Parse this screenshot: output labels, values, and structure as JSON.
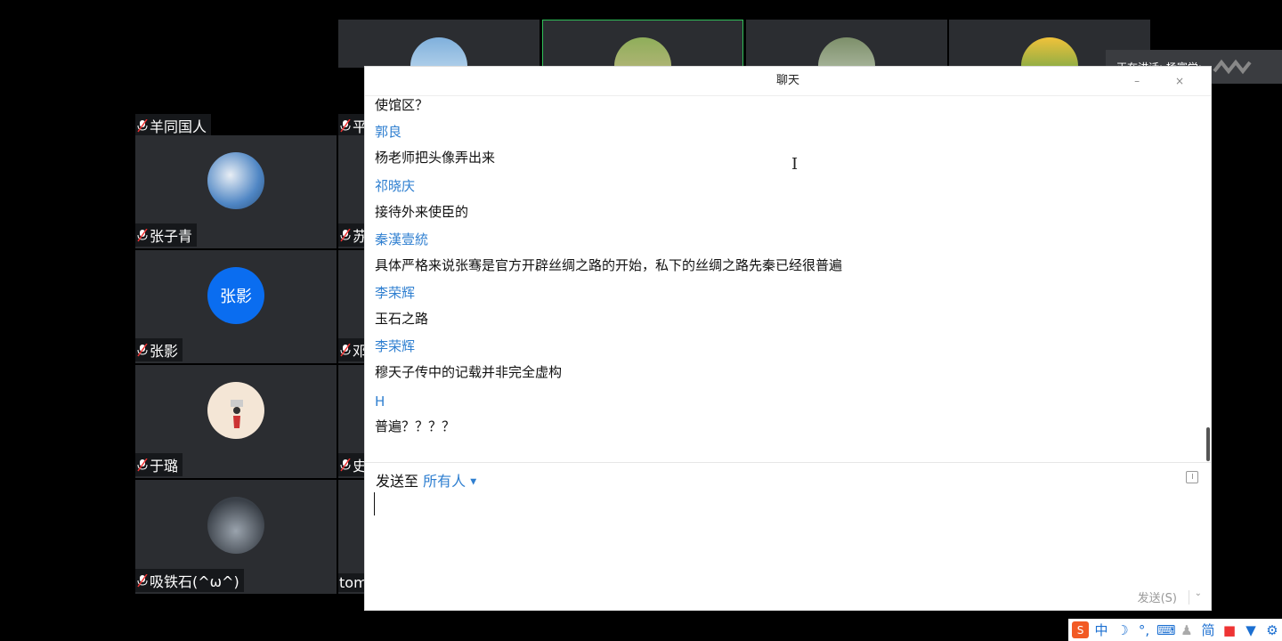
{
  "grid": {
    "tiles_left": [
      {
        "name": "羊同国人",
        "avatar_text": ""
      },
      {
        "name": "张子青",
        "avatar_text": ""
      },
      {
        "name": "张影",
        "avatar_text": "张影"
      },
      {
        "name": "于璐",
        "avatar_text": ""
      },
      {
        "name": "吸铁石(^ω^)",
        "avatar_text": ""
      }
    ],
    "tiles_col2": [
      {
        "name": "平"
      },
      {
        "name": "苏"
      },
      {
        "name": "邓"
      },
      {
        "name": "史"
      },
      {
        "name": "tom"
      }
    ]
  },
  "speaking": {
    "label": "正在讲话: 杨富学;"
  },
  "chat": {
    "title": "聊天",
    "messages": [
      {
        "text": "使馆区？"
      },
      {
        "sender": "郭良",
        "text": "杨老师把头像弄出来"
      },
      {
        "sender": "祁晓庆",
        "text": "接待外来使臣的"
      },
      {
        "sender": "秦漢壹統",
        "text": "具体严格来说张骞是官方开辟丝绸之路的开始，私下的丝绸之路先秦已经很普遍"
      },
      {
        "sender": "李荣辉",
        "text": "玉石之路"
      },
      {
        "sender": "李荣辉",
        "text": "穆天子传中的记载并非完全虚构"
      },
      {
        "sender": "H",
        "text": "普遍？？？？"
      }
    ],
    "send_to_label": "发送至",
    "send_to_target": "所有人",
    "send_button": "发送(S)"
  },
  "ime": {
    "items": [
      "中",
      "简"
    ]
  },
  "colors": {
    "accent": "#2f7fd0",
    "tile_bg": "#2b2d31",
    "active_border": "#2fbf58",
    "avatar_blue": "#0a6df0"
  }
}
